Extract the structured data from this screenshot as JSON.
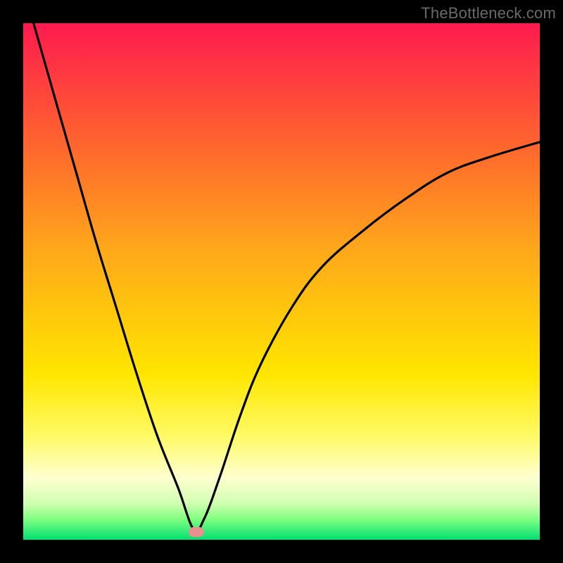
{
  "watermark": "TheBottleneck.com",
  "marker": {
    "x_frac": 0.335,
    "y_frac": 0.985
  },
  "chart_data": {
    "type": "line",
    "title": "",
    "xlabel": "",
    "ylabel": "",
    "xlim": [
      0,
      100
    ],
    "ylim": [
      0,
      100
    ],
    "grid": false,
    "legend": false,
    "series": [
      {
        "name": "bottleneck-curve",
        "x": [
          2,
          6,
          10,
          14,
          18,
          22,
          26,
          30,
          33,
          35,
          38,
          42,
          46,
          52,
          58,
          66,
          74,
          82,
          90,
          100
        ],
        "y": [
          100,
          86,
          72,
          58,
          45,
          32,
          20,
          10,
          2,
          4,
          12,
          24,
          34,
          45,
          53,
          60,
          66,
          71,
          74,
          77
        ]
      }
    ],
    "background_gradient": {
      "orientation": "vertical",
      "stops": [
        {
          "pos": 0.0,
          "color": "#ff1a4e"
        },
        {
          "pos": 0.1,
          "color": "#ff3a40"
        },
        {
          "pos": 0.25,
          "color": "#ff6a2c"
        },
        {
          "pos": 0.44,
          "color": "#ffa81a"
        },
        {
          "pos": 0.68,
          "color": "#ffe600"
        },
        {
          "pos": 0.8,
          "color": "#fffa66"
        },
        {
          "pos": 0.88,
          "color": "#ffffd0"
        },
        {
          "pos": 0.93,
          "color": "#d0ffb0"
        },
        {
          "pos": 0.96,
          "color": "#80ff80"
        },
        {
          "pos": 1.0,
          "color": "#00e070"
        }
      ]
    },
    "annotations": [
      {
        "type": "marker",
        "x": 33.5,
        "y": 1.5,
        "shape": "pill",
        "color": "#e98f8f"
      }
    ]
  }
}
